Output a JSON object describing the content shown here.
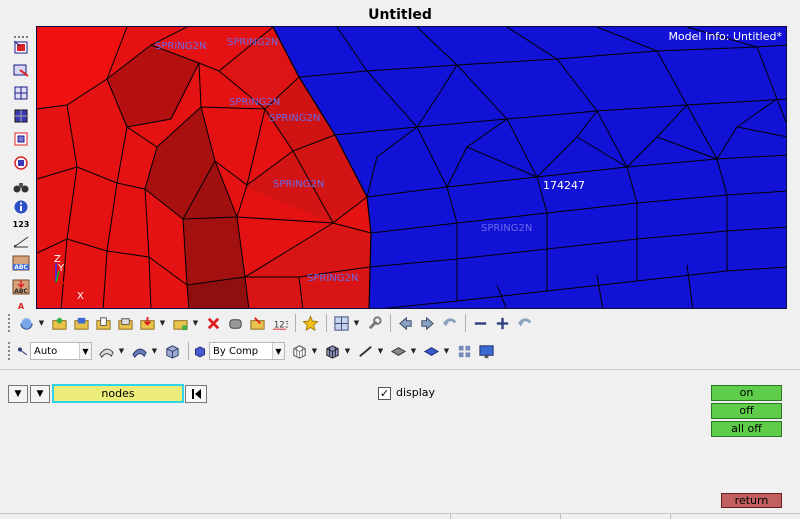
{
  "window": {
    "title": "Untitled"
  },
  "viewport": {
    "model_info": "Model Info: Untitled*",
    "labels": [
      {
        "id": "spring-1",
        "text": "SPRING2N"
      },
      {
        "id": "spring-2",
        "text": "SPRING2N"
      },
      {
        "id": "spring-3",
        "text": "SPRING2N"
      },
      {
        "id": "spring-4",
        "text": "SPRING2N"
      },
      {
        "id": "spring-5",
        "text": "SPRING2N"
      },
      {
        "id": "spring-6",
        "text": "SPRING2N"
      },
      {
        "id": "spring-7",
        "text": "SPRING2N"
      }
    ],
    "element_id": "174247",
    "axes": {
      "z": "Z",
      "y": "Y",
      "x": "X"
    },
    "colors": {
      "component_a": "#e01010",
      "component_b": "#1414d4",
      "edges": "#000000"
    }
  },
  "left_toolbar": {
    "items": [
      {
        "name": "visualization-icon"
      },
      {
        "name": "show-elements-icon"
      },
      {
        "name": "mask-elements-icon"
      },
      {
        "name": "shade-elements-icon"
      },
      {
        "name": "iso-view-icon"
      },
      {
        "name": "find-icon"
      },
      {
        "name": "info-icon"
      },
      {
        "name": "numbers-icon",
        "text": "123"
      },
      {
        "name": "measure-icon"
      },
      {
        "name": "label-abc-icon",
        "text": "ABC"
      },
      {
        "name": "label-abc-down-icon",
        "text": "ABC"
      },
      {
        "name": "annotation-icon",
        "text": "A"
      }
    ]
  },
  "toolbar2": {
    "auto_select": "Auto",
    "by_comp": "By Comp"
  },
  "panel": {
    "nodes_label": "nodes",
    "display_label": "display",
    "display_checked": "✓",
    "on_label": "on",
    "off_label": "off",
    "alloff_label": "all off",
    "return_label": "return"
  }
}
